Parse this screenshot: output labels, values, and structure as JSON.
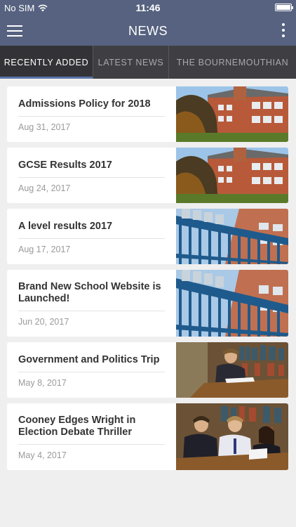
{
  "status": {
    "carrier": "No SIM",
    "time": "11:46"
  },
  "header": {
    "title": "NEWS"
  },
  "tabs": [
    {
      "label": "RECENTLY ADDED",
      "active": true
    },
    {
      "label": "LATEST NEWS",
      "active": false
    },
    {
      "label": "THE BOURNEMOUTHIAN",
      "active": false
    }
  ],
  "articles": [
    {
      "title": "Admissions Policy for 2018",
      "date": "Aug 31, 2017",
      "image": "school-building"
    },
    {
      "title": "GCSE Results 2017",
      "date": "Aug 24, 2017",
      "image": "school-building"
    },
    {
      "title": "A level results 2017",
      "date": "Aug 17, 2017",
      "image": "school-gate-sign"
    },
    {
      "title": "Brand New School Website is Launched!",
      "date": "Jun 20, 2017",
      "image": "school-gate-sign"
    },
    {
      "title": "Government and Politics Trip",
      "date": "May 8, 2017",
      "image": "library-student"
    },
    {
      "title": "Cooney Edges Wright in Election Debate Thriller",
      "date": "May 4, 2017",
      "image": "library-debate"
    }
  ],
  "colors": {
    "navbar": "#56627f",
    "tabbar": "#3f3f43",
    "tab_active_indicator": "#5a73a8",
    "background": "#efefef"
  }
}
